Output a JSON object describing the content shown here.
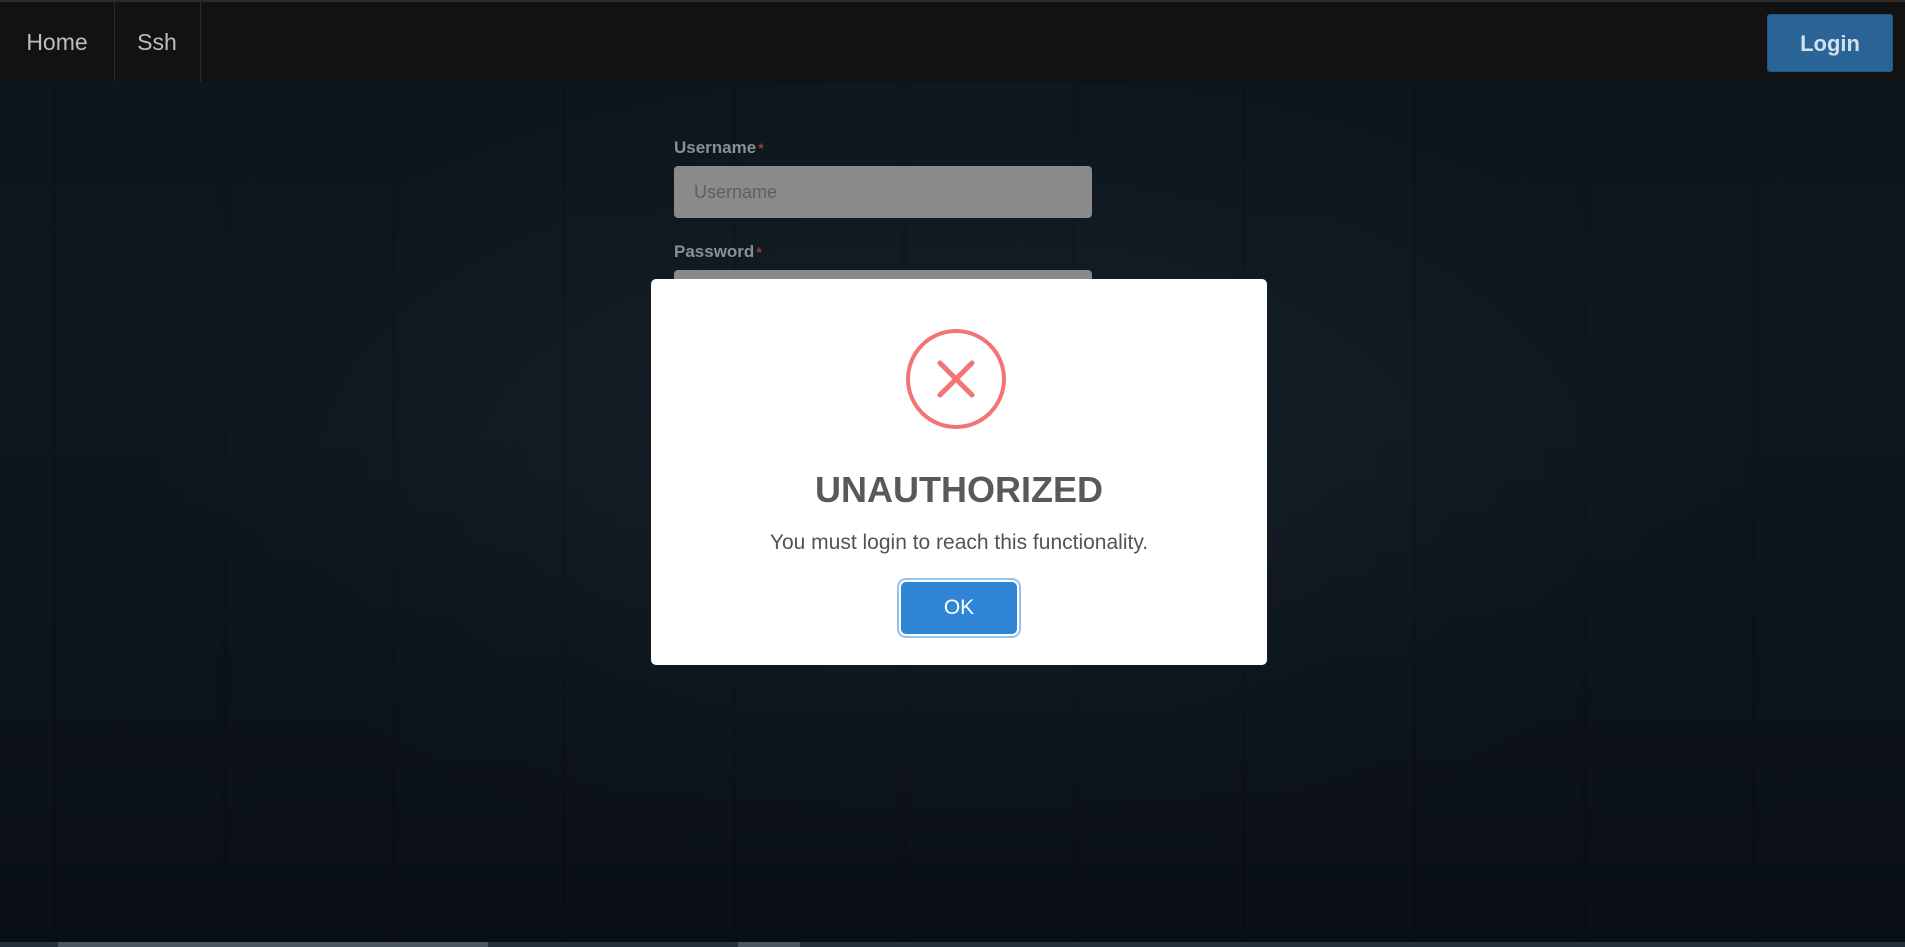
{
  "nav": {
    "home": "Home",
    "ssh": "Ssh",
    "login": "Login"
  },
  "form": {
    "username_label": "Username",
    "username_placeholder": "Username",
    "password_label": "Password",
    "required_mark": "*"
  },
  "modal": {
    "title": "UNAUTHORIZED",
    "message": "You must login to reach this functionality.",
    "ok": "OK",
    "icon": "error-x-icon"
  },
  "colors": {
    "navbar_bg": "#121212",
    "login_button": "#2a6496",
    "error_red": "#f27474",
    "ok_button": "#3085d6"
  }
}
